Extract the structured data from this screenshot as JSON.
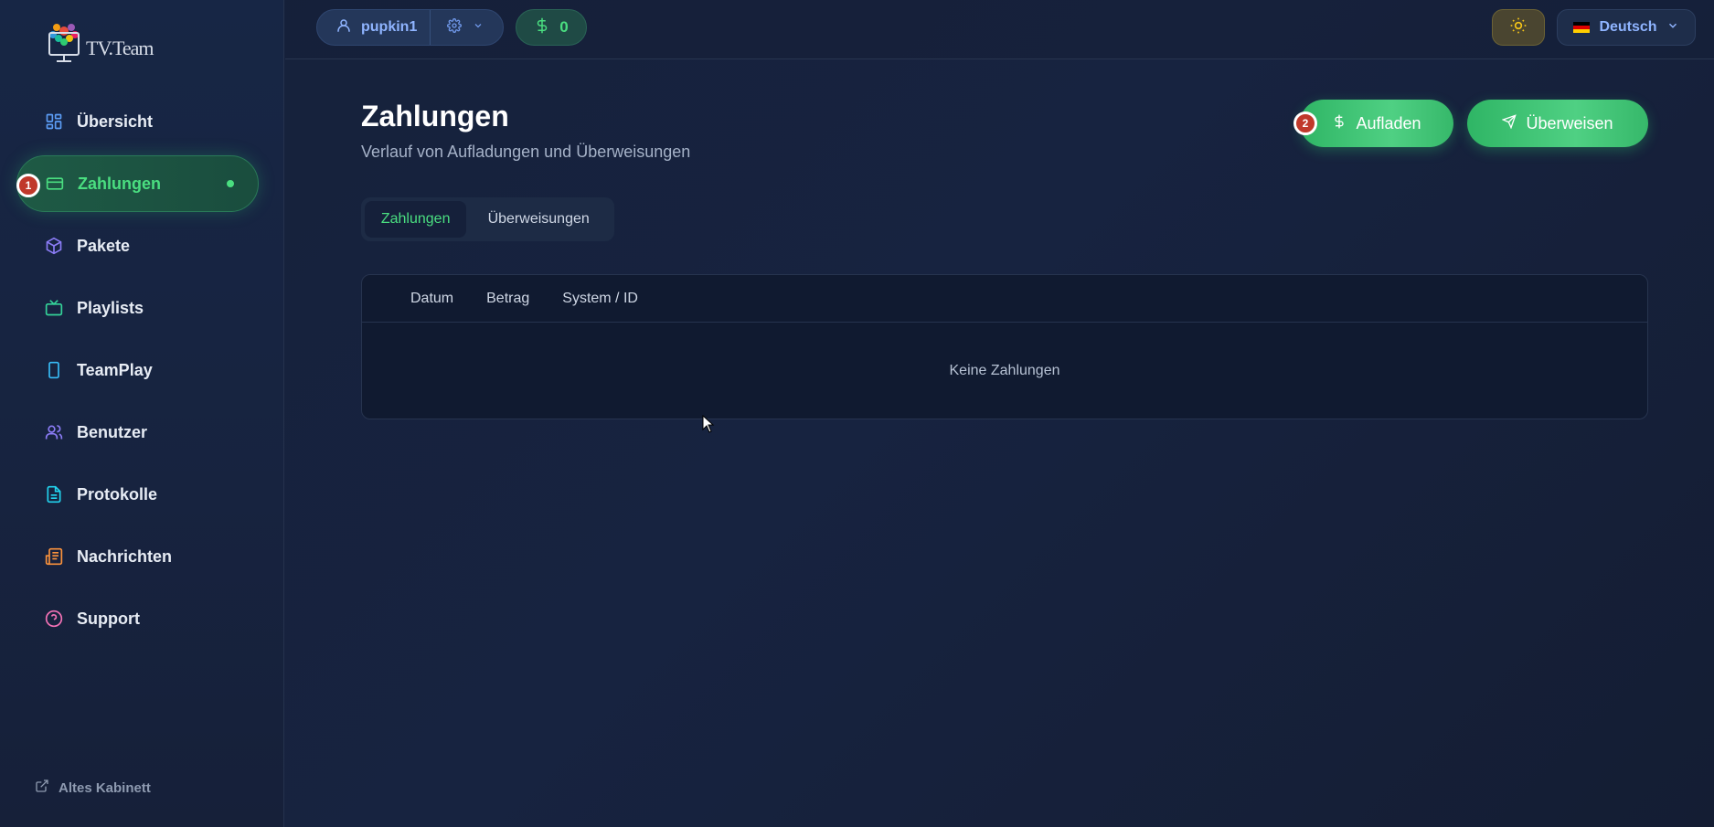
{
  "brand": {
    "logo_text": "TV.Team"
  },
  "sidebar": {
    "items": [
      {
        "label": "Übersicht",
        "icon": "grid-icon",
        "color": "#5b9cf5"
      },
      {
        "label": "Zahlungen",
        "icon": "credit-card-icon",
        "color": "#4ade80",
        "active": true
      },
      {
        "label": "Pakete",
        "icon": "package-icon",
        "color": "#8b7cf6"
      },
      {
        "label": "Playlists",
        "icon": "tv-icon",
        "color": "#34d399"
      },
      {
        "label": "TeamPlay",
        "icon": "smartphone-icon",
        "color": "#38bdf8"
      },
      {
        "label": "Benutzer",
        "icon": "users-icon",
        "color": "#8b7cf6"
      },
      {
        "label": "Protokolle",
        "icon": "file-text-icon",
        "color": "#22d3ee"
      },
      {
        "label": "Nachrichten",
        "icon": "newspaper-icon",
        "color": "#fb923c"
      },
      {
        "label": "Support",
        "icon": "help-circle-icon",
        "color": "#f472b6"
      }
    ],
    "old_cabinet": "Altes Kabinett"
  },
  "topbar": {
    "username": "pupkin1",
    "balance": "0",
    "language": "Deutsch"
  },
  "main": {
    "title": "Zahlungen",
    "subtitle": "Verlauf von Aufladungen und Überweisungen",
    "topup_label": "Aufladen",
    "transfer_label": "Überweisen",
    "tabs": [
      {
        "label": "Zahlungen",
        "active": true
      },
      {
        "label": "Überweisungen",
        "active": false
      }
    ],
    "table": {
      "columns": [
        "Datum",
        "Betrag",
        "System / ID"
      ],
      "empty_text": "Keine Zahlungen"
    }
  },
  "annotations": {
    "marker_1": "1",
    "marker_2": "2"
  },
  "colors": {
    "accent": "#4ade80",
    "link": "#8fb4ff",
    "background": "#16213a"
  }
}
